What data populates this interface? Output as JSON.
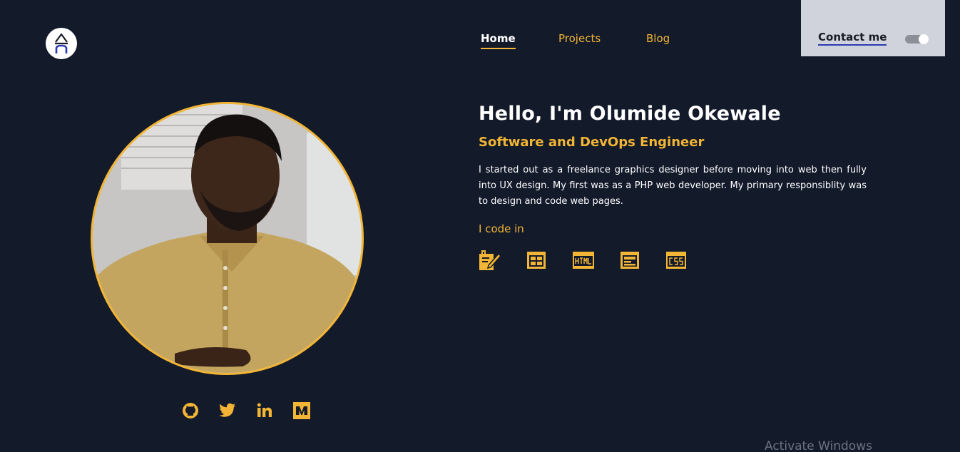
{
  "header": {
    "logo_icon": "brand-logo-icon",
    "nav": [
      {
        "label": "Home",
        "active": true
      },
      {
        "label": "Projects",
        "active": false
      },
      {
        "label": "Blog",
        "active": false
      }
    ],
    "contact_label": "Contact me",
    "theme_toggle_on": true
  },
  "hero": {
    "title": "Hello, I'm Olumide Okewale",
    "subtitle": "Software and DevOps Engineer",
    "bio": "I started out as a freelance graphics designer before moving into web then fully into UX design. My first was as a PHP web developer. My primary responsiblity was to design and code web pages.",
    "code_label": "I code in",
    "tech_icons": [
      "design-tool-icon",
      "layout-icon",
      "html-icon",
      "web-page-icon",
      "css-icon"
    ]
  },
  "socials": [
    "github-icon",
    "twitter-icon",
    "linkedin-icon",
    "medium-icon"
  ],
  "watermark": "Activate Windows",
  "colors": {
    "background": "#131a2a",
    "accent": "#f2b535",
    "contact_panel": "#d1d3dc",
    "text": "#ffffff"
  }
}
